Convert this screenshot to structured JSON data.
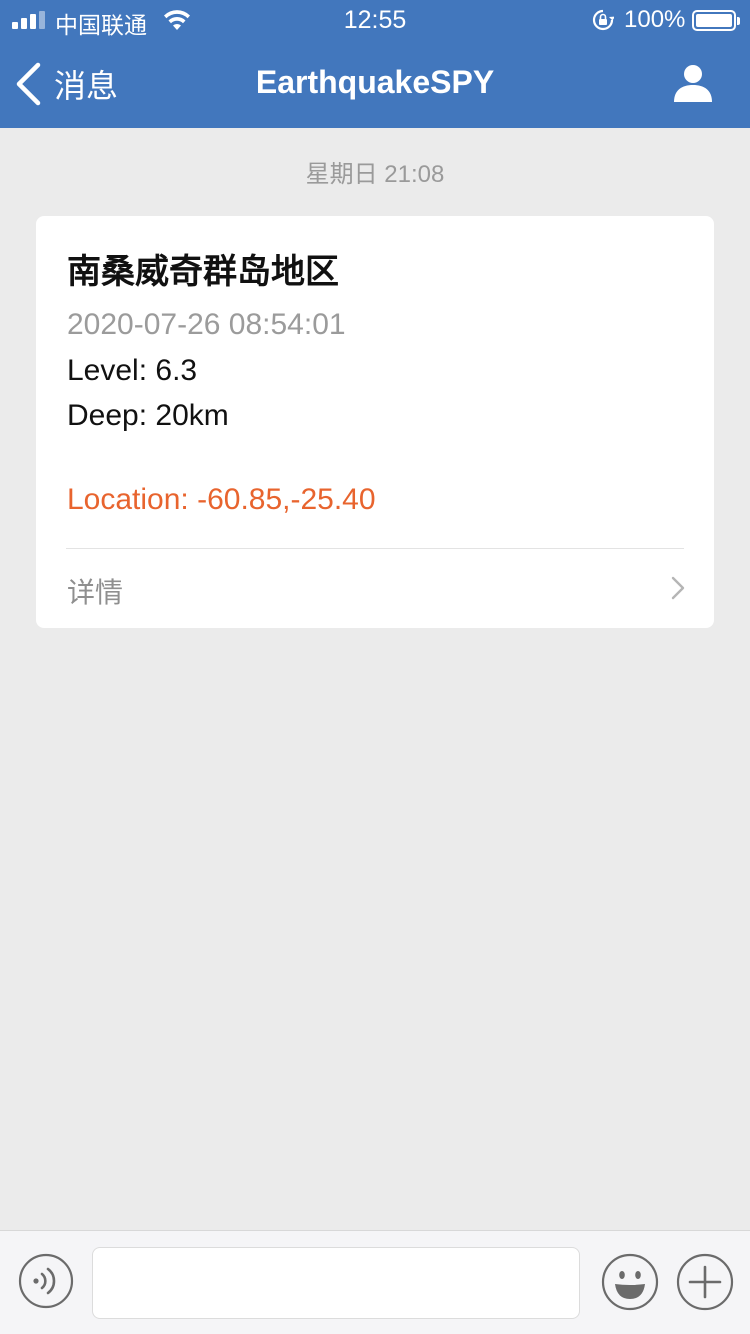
{
  "status_bar": {
    "carrier": "中国联通",
    "time": "12:55",
    "battery": "100%"
  },
  "nav": {
    "back_label": "消息",
    "title": "EarthquakeSPY"
  },
  "chat": {
    "timestamp": "星期日 21:08"
  },
  "card": {
    "title": "南桑威奇群岛地区",
    "date": "2020-07-26 08:54:01",
    "level": "Level:  6.3",
    "deep": "Deep:  20km",
    "location": "Location:  -60.85,-25.40",
    "details_label": "详情"
  },
  "colors": {
    "header": "#4277bd",
    "location": "#e8642e",
    "background": "#ebebeb"
  },
  "icons": [
    "signal-icon",
    "wifi-icon",
    "rotation-lock-icon",
    "battery-icon",
    "back-chevron-icon",
    "person-icon",
    "chevron-right-icon",
    "voice-icon",
    "emoji-icon",
    "plus-icon"
  ]
}
